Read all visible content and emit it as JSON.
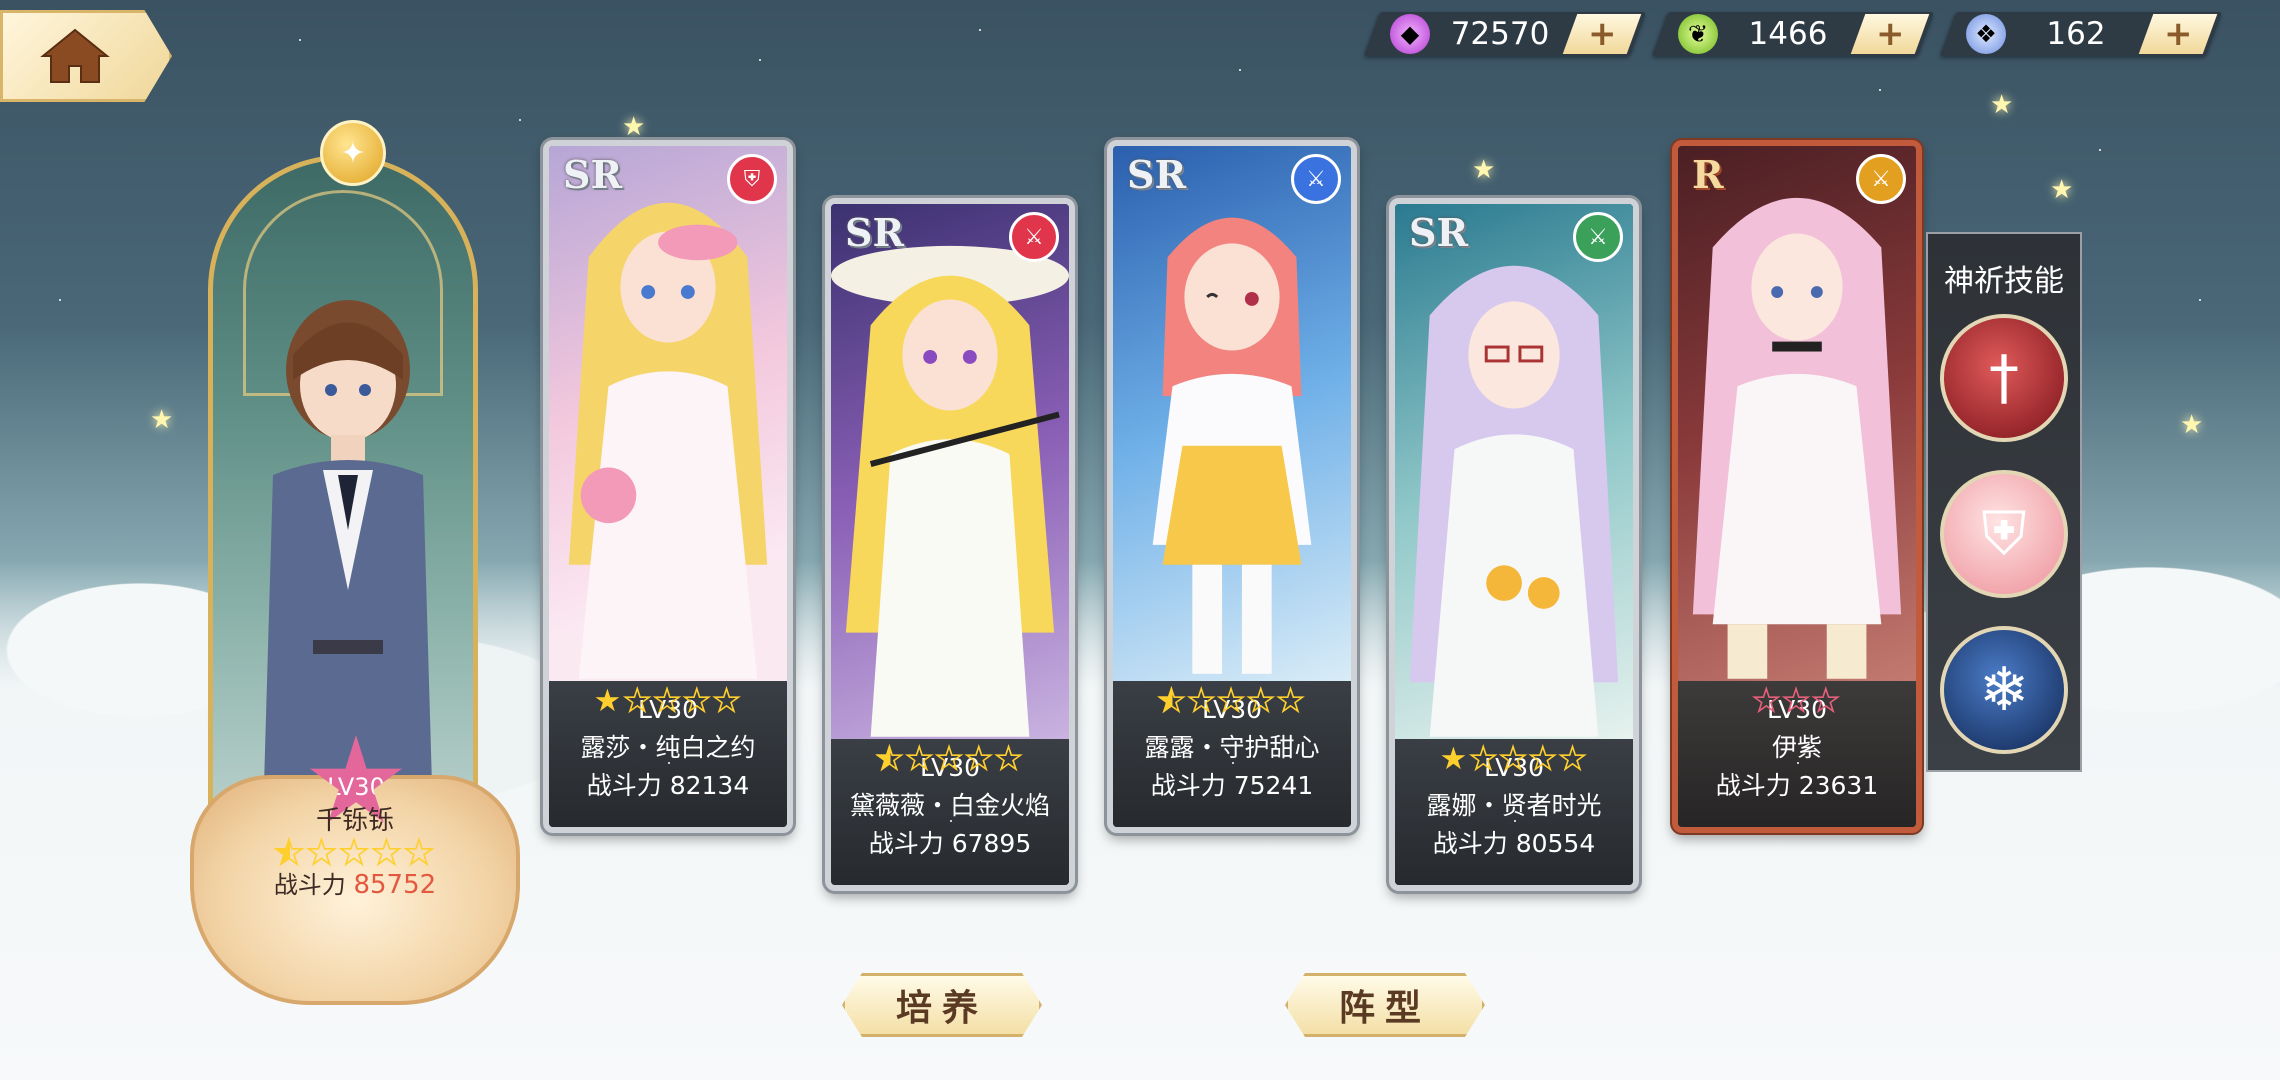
{
  "currencies": [
    {
      "icon": "purple-gem-icon",
      "value": "72570",
      "color": "#c04dd8"
    },
    {
      "icon": "green-leaf-icon",
      "value": "1466",
      "color": "#8ed43a"
    },
    {
      "icon": "blue-crystal-icon",
      "value": "162",
      "color": "#6ea8ff"
    }
  ],
  "currency_plus": "+",
  "hero": {
    "level": "LV30",
    "name": "千铄铄",
    "stars": "★☆☆☆☆",
    "power_label": "战斗力",
    "power": "85752"
  },
  "cards": [
    {
      "rarity": "SR",
      "role": "shield-role-icon",
      "role_color": "#e0354a",
      "level": "LV30",
      "name": "露莎・纯白之约",
      "stars_on": 1,
      "stars_half": 0,
      "stars_total": 5,
      "power": "战斗力 82134"
    },
    {
      "rarity": "SR",
      "role": "sword-role-icon",
      "role_color": "#e0354a",
      "level": "LV30",
      "name": "黛薇薇・白金火焰",
      "stars_on": 0,
      "stars_half": 1,
      "stars_total": 5,
      "power": "战斗力 67895"
    },
    {
      "rarity": "SR",
      "role": "sword-role-icon",
      "role_color": "#3a72e0",
      "level": "LV30",
      "name": "露露・守护甜心",
      "stars_on": 0,
      "stars_half": 1,
      "stars_total": 5,
      "power": "战斗力 75241"
    },
    {
      "rarity": "SR",
      "role": "sword-role-icon",
      "role_color": "#3aa05a",
      "level": "LV30",
      "name": "露娜・贤者时光",
      "stars_on": 1,
      "stars_half": 0,
      "stars_total": 5,
      "power": "战斗力 80554"
    },
    {
      "rarity": "R",
      "role": "sword-role-icon",
      "role_color": "#e3a020",
      "level": "LV30",
      "name": "伊紫",
      "stars_on": 0,
      "stars_half": 0,
      "stars_total": 3,
      "power": "战斗力 23631"
    }
  ],
  "skills": {
    "title": "神祈技能",
    "items": [
      {
        "icon": "red-sword-skill-icon",
        "color": "#a8242a"
      },
      {
        "icon": "pink-shield-skill-icon",
        "color": "#f2a6a6"
      },
      {
        "icon": "blue-snowflake-skill-icon",
        "color": "#1e3e78"
      }
    ]
  },
  "buttons": {
    "train": "培养",
    "formation": "阵型"
  }
}
